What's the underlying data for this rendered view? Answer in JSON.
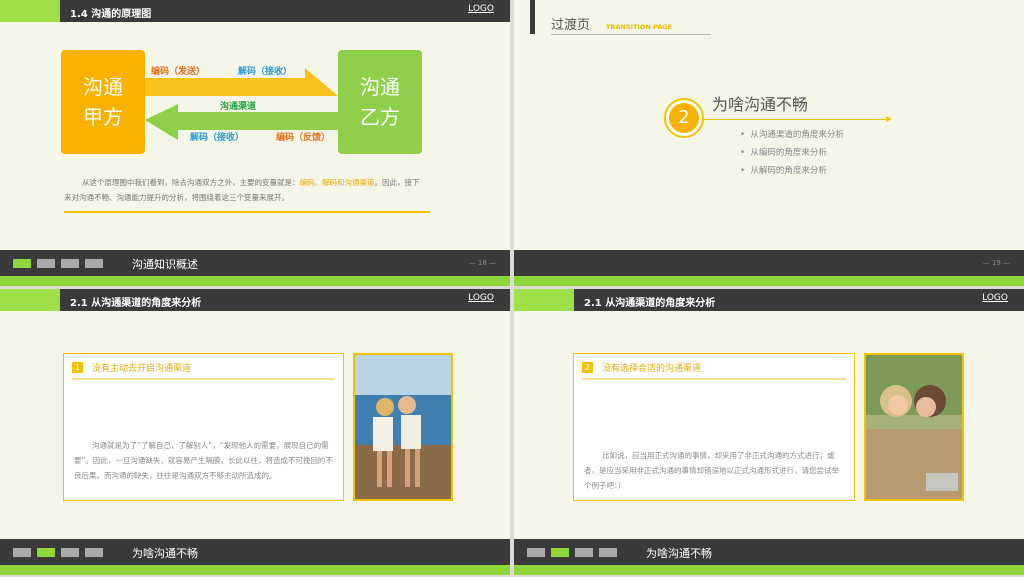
{
  "slide1": {
    "header": "1.4 沟通的原理图",
    "logo": "LOGO",
    "left_box": "沟通甲方",
    "right_box": "沟通乙方",
    "label_encode_send": "编码（发送）",
    "label_decode_receive": "解码（接收）",
    "label_channel": "沟通渠道",
    "label_decode_receive2": "解码（接收）",
    "label_encode_feedback": "编码（反馈）",
    "paragraph_pre": "从这个原理图中我们看到，除去沟通双方之外，主要的变量就是：",
    "paragraph_highlight": "编码、解码和沟通渠道",
    "paragraph_post": "。因此，接下来对沟通不畅、沟通能力提升的分析，将围绕着这三个变量来展开。",
    "footer_title": "沟通知识概述",
    "page": "— 18 —"
  },
  "slide2": {
    "header": "过渡页",
    "header_en": "TRANSITION PAGE",
    "number": "2",
    "title": "为啥沟通不畅",
    "bullets": [
      "从沟通渠道的角度来分析",
      "从编码的角度来分析",
      "从解码的角度来分析"
    ],
    "page": "— 19 —"
  },
  "slide3": {
    "header": "2.1 从沟通渠道的角度来分析",
    "logo": "LOGO",
    "num": "1",
    "card_title": "没有主动去开启沟通渠道",
    "card_text": "沟通就是为了“了解自己，了解别人”，“发现他人的需要，展现自己的需要”。因此，一旦沟通缺失，就容易产生隔膜，长此以往，将造成不可挽回的不良后果。而沟通的缺失，往往是沟通双方不够主动所造成的。",
    "footer_title": "为啥沟通不畅"
  },
  "slide4": {
    "header": "2.1 从沟通渠道的角度来分析",
    "logo": "LOGO",
    "num": "2",
    "card_title": "没有选择合适的沟通渠道",
    "card_text": "比如说，应当用正式沟通的事情，却采用了非正式沟通的方式进行；或者，是应当采用非正式沟通的事情却错误地以正式沟通形式进行，请您尝试举个例子吧：）",
    "footer_title": "为啥沟通不畅"
  },
  "colors": {
    "green": "#8fd63c",
    "orange": "#f9b200",
    "dark": "#3a3a3a",
    "yellow": "#f2c200"
  }
}
